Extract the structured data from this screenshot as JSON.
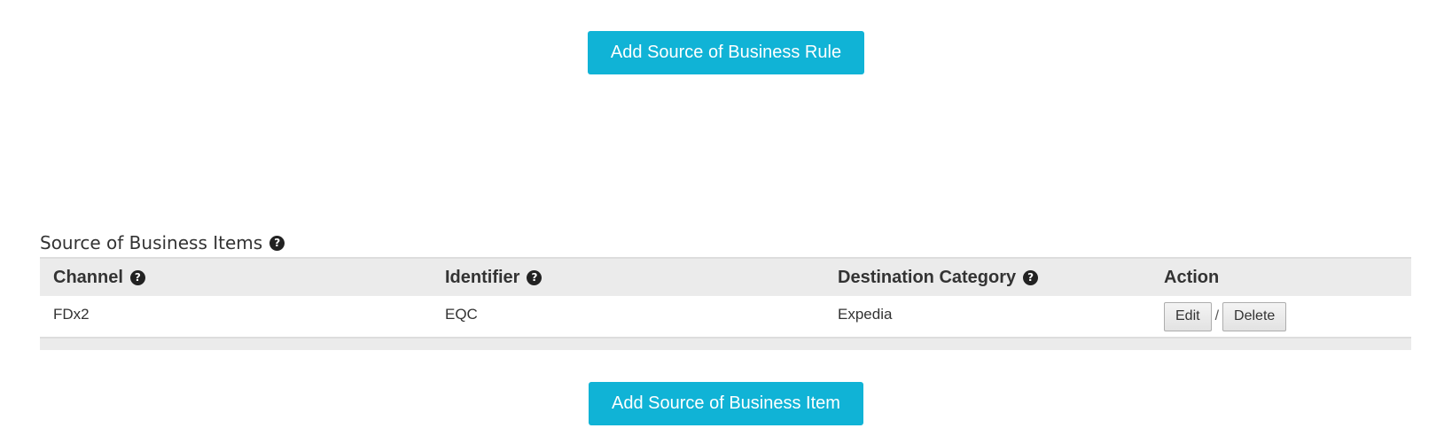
{
  "buttons": {
    "add_rule": "Add Source of Business Rule",
    "add_item": "Add Source of Business Item"
  },
  "section": {
    "title": "Source of Business Items",
    "help_glyph": "?"
  },
  "table": {
    "headers": {
      "channel": "Channel",
      "identifier": "Identifier",
      "destination_category": "Destination Category",
      "action": "Action"
    },
    "rows": [
      {
        "channel": "FDx2",
        "identifier": "EQC",
        "destination_category": "Expedia",
        "edit_label": "Edit",
        "separator": "/",
        "delete_label": "Delete"
      }
    ]
  },
  "colors": {
    "primary_button": "#10b3d6",
    "table_header_bg": "#ebebeb",
    "text": "#333333"
  },
  "icons": {
    "help": "question-circle-icon"
  }
}
